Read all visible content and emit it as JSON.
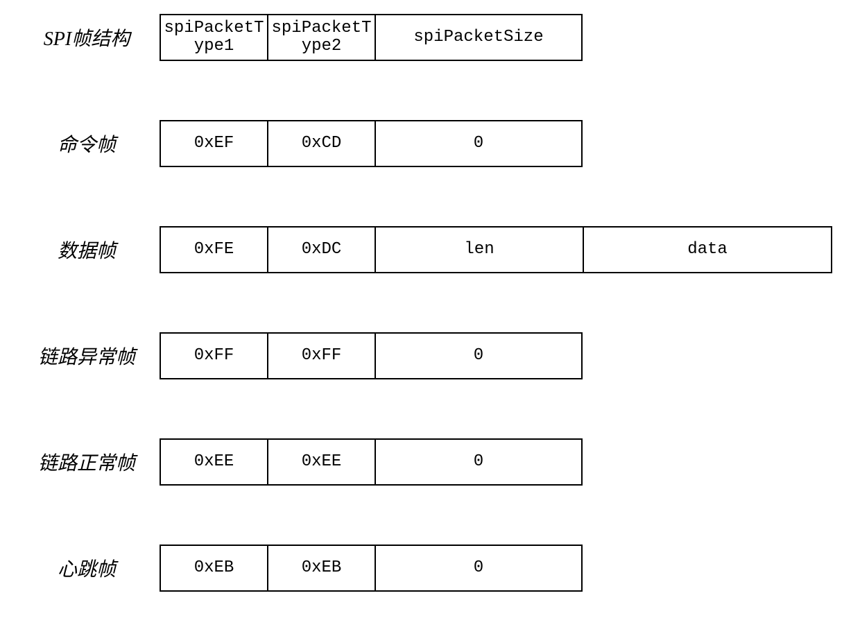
{
  "rows": [
    {
      "label": "SPI帧结构",
      "cells": [
        {
          "text": "spiPacketT\nype1",
          "cls": "w-type"
        },
        {
          "text": "spiPacketT\nype2",
          "cls": "w-type"
        },
        {
          "text": "spiPacketSize",
          "cls": "w-size"
        }
      ]
    },
    {
      "label": "命令帧",
      "cells": [
        {
          "text": "0xEF",
          "cls": "w-type"
        },
        {
          "text": "0xCD",
          "cls": "w-type"
        },
        {
          "text": "0",
          "cls": "w-size"
        }
      ]
    },
    {
      "label": "数据帧",
      "cells": [
        {
          "text": "0xFE",
          "cls": "w-type"
        },
        {
          "text": "0xDC",
          "cls": "w-type"
        },
        {
          "text": "len",
          "cls": "w-size"
        },
        {
          "text": "data",
          "cls": "w-data"
        }
      ]
    },
    {
      "label": "链路异常帧",
      "cells": [
        {
          "text": "0xFF",
          "cls": "w-type"
        },
        {
          "text": "0xFF",
          "cls": "w-type"
        },
        {
          "text": "0",
          "cls": "w-size"
        }
      ]
    },
    {
      "label": "链路正常帧",
      "cells": [
        {
          "text": "0xEE",
          "cls": "w-type"
        },
        {
          "text": "0xEE",
          "cls": "w-type"
        },
        {
          "text": "0",
          "cls": "w-size"
        }
      ]
    },
    {
      "label": "心跳帧",
      "cells": [
        {
          "text": "0xEB",
          "cls": "w-type"
        },
        {
          "text": "0xEB",
          "cls": "w-type"
        },
        {
          "text": "0",
          "cls": "w-size"
        }
      ]
    }
  ]
}
